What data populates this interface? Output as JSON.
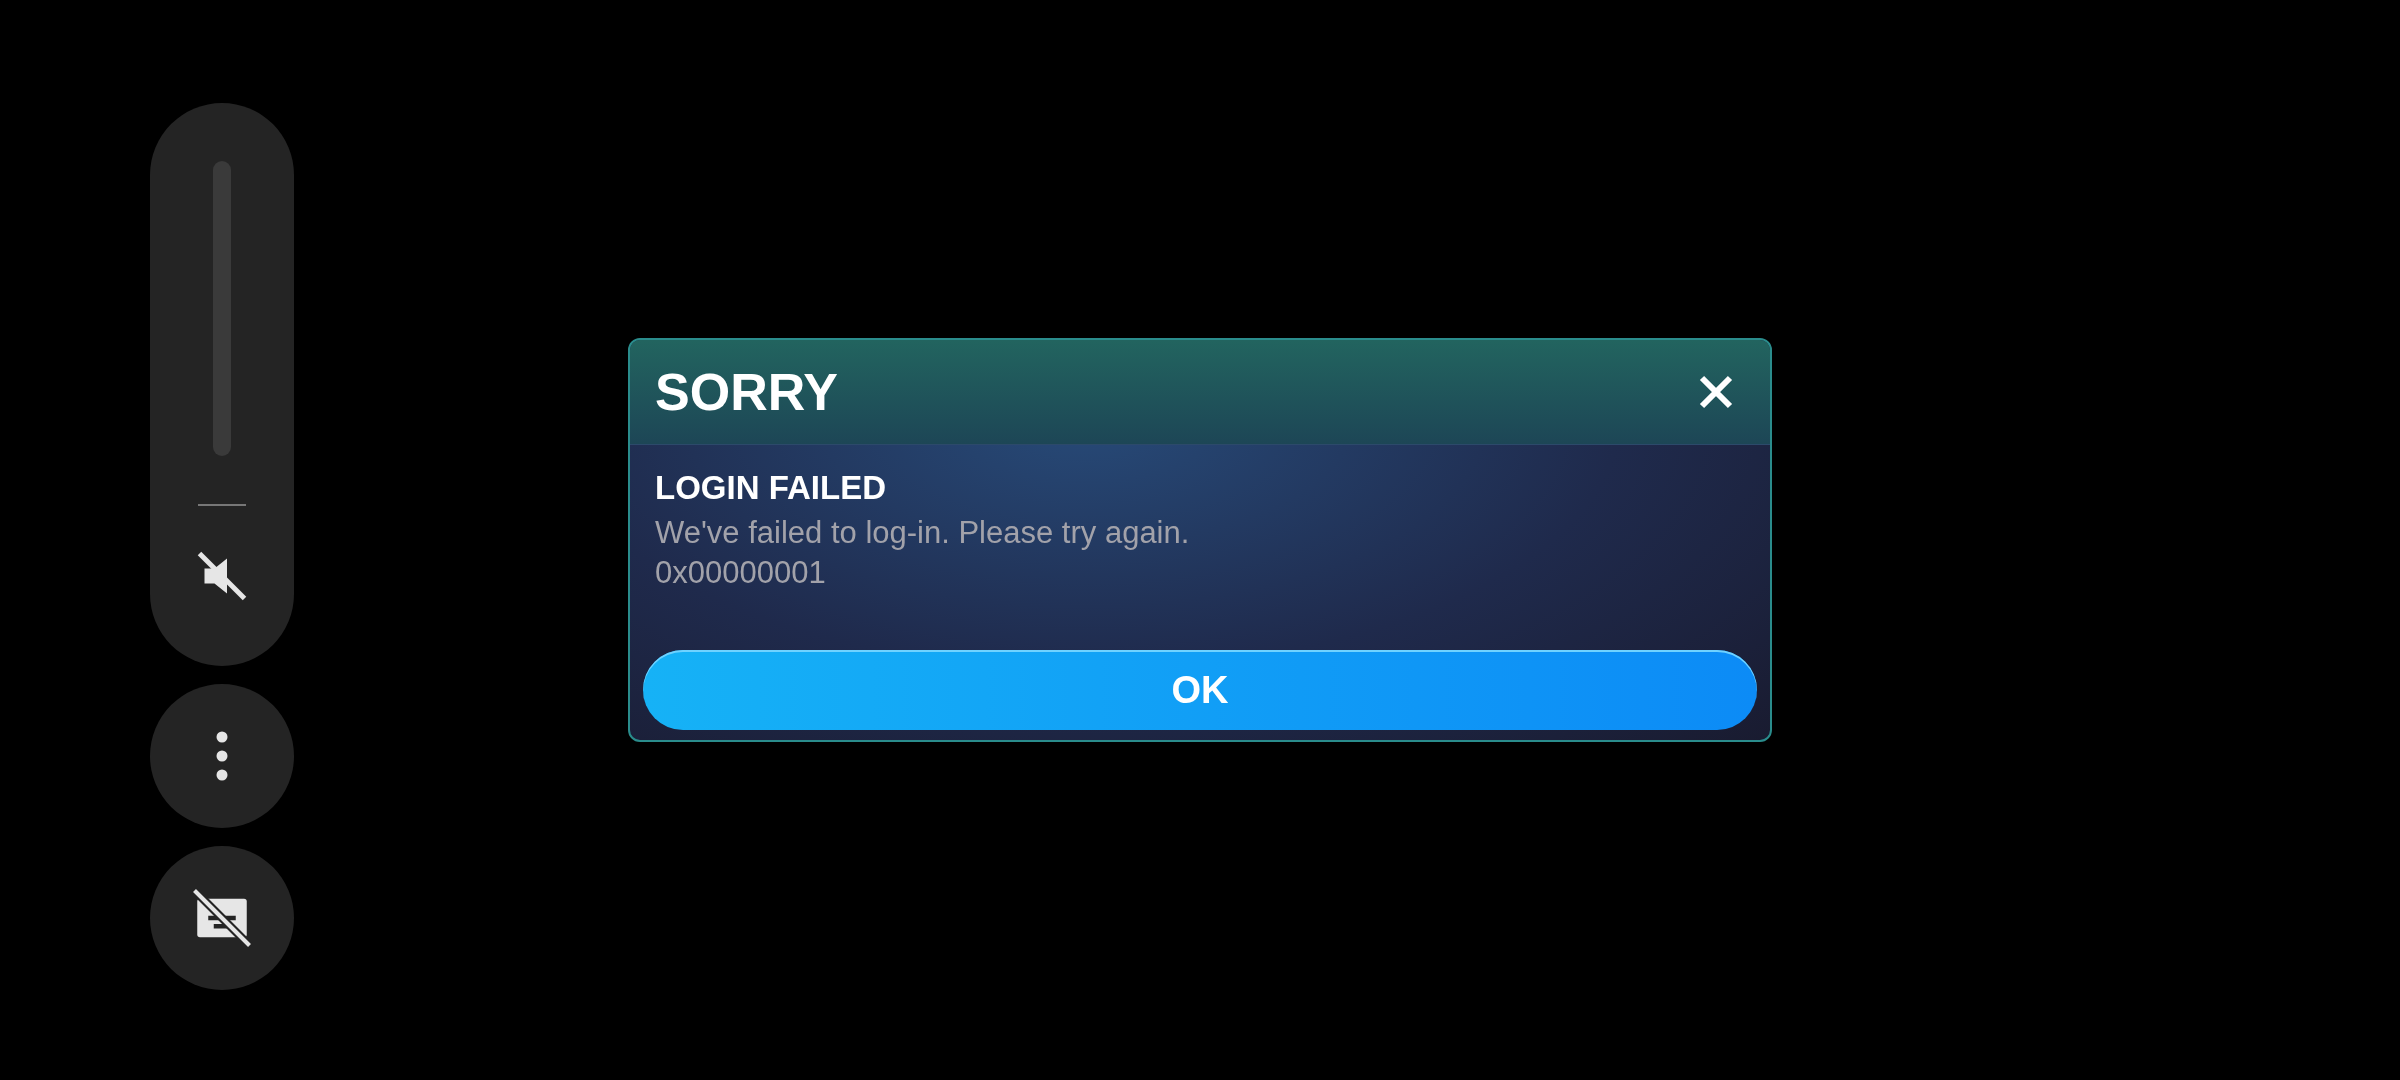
{
  "volume": {
    "level": 0,
    "muted": true
  },
  "more_button": {
    "kind": "menu"
  },
  "captions": {
    "on": false
  },
  "dialog": {
    "title": "SORRY",
    "heading": "LOGIN FAILED",
    "message": "We've failed to log-in. Please try again.",
    "code": "0x00000001",
    "button": "OK"
  }
}
